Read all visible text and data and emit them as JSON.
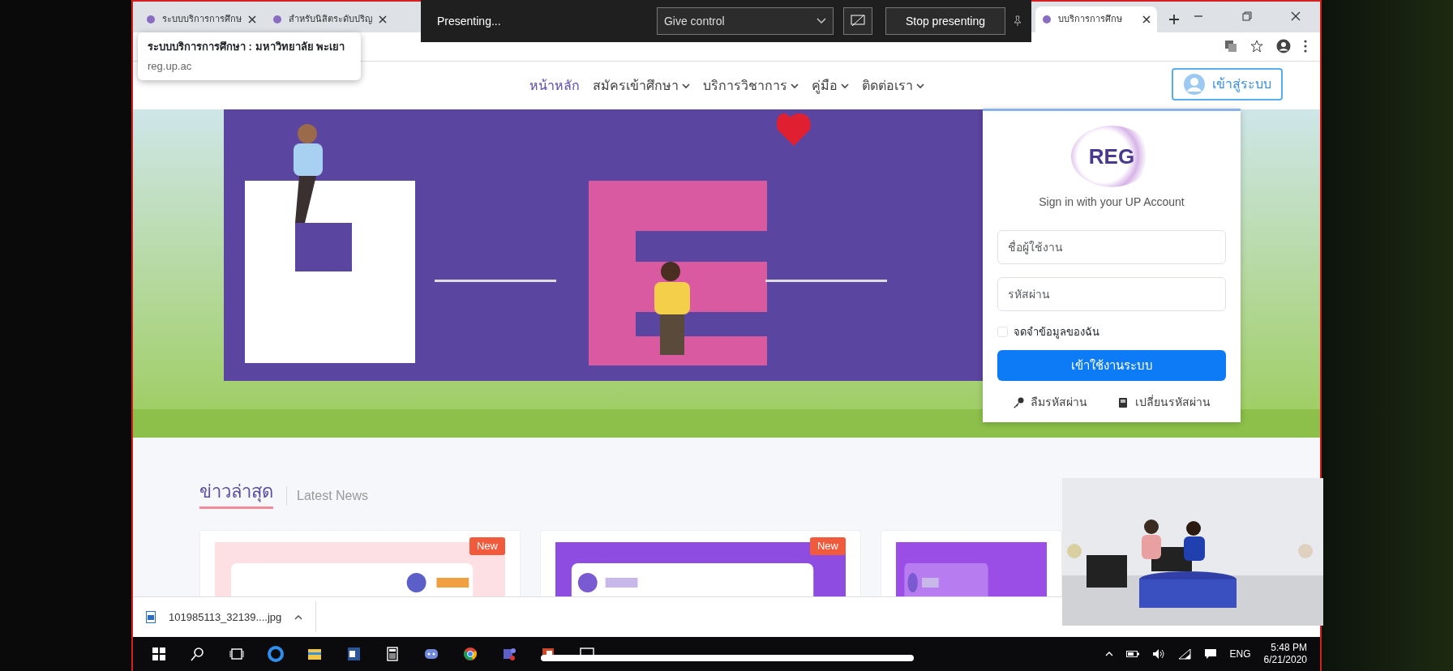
{
  "browser": {
    "tabs": [
      {
        "title": "ระบบบริการการศึกษ",
        "selected": false
      },
      {
        "title": "สำหรับนิสิตระดับปริญ",
        "selected": false
      },
      {
        "title": "บบริการการศึกษ",
        "selected": true
      }
    ],
    "tooltip": {
      "title": "ระบบบริการการศึกษา : มหาวิทยาลัย พะเยา",
      "url": "reg.up.ac"
    },
    "download": {
      "file": "101985113_32139....jpg"
    }
  },
  "presenting_bar": {
    "status": "Presenting...",
    "give_control": "Give control",
    "stop": "Stop presenting"
  },
  "site_nav": {
    "items": [
      {
        "label": "หน้าหลัก",
        "selected": true,
        "dropdown": false
      },
      {
        "label": "สมัครเข้าศึกษา",
        "selected": false,
        "dropdown": true
      },
      {
        "label": "บริการวิชาการ",
        "selected": false,
        "dropdown": true
      },
      {
        "label": "คู่มือ",
        "selected": false,
        "dropdown": true
      },
      {
        "label": "ติดต่อเรา",
        "selected": false,
        "dropdown": true
      }
    ],
    "login_button": "เข้าสู่ระบบ"
  },
  "login": {
    "logo_text": "REG",
    "subtitle": "Sign in with your UP Account",
    "username": {
      "placeholder": "ชื่อผู้ใช้งาน"
    },
    "password": {
      "placeholder": "รหัสผ่าน"
    },
    "remember": {
      "label": "จดจำข้อมูลของฉัน",
      "checked": false
    },
    "submit": "เข้าใช้งานระบบ",
    "forgot": "ลืมรหัสผ่าน",
    "change": "เปลี่ยนรหัสผ่าน"
  },
  "news": {
    "title": "ข่าวล่าสุด",
    "subtitle": "Latest News",
    "cards": [
      {
        "badge": "New",
        "kind": "picture"
      },
      {
        "badge": "New",
        "kind": "picture"
      },
      {
        "kind": "picture"
      }
    ]
  },
  "taskbar": {
    "language": "ENG",
    "time": "5:48 PM",
    "date": "6/21/2020"
  }
}
